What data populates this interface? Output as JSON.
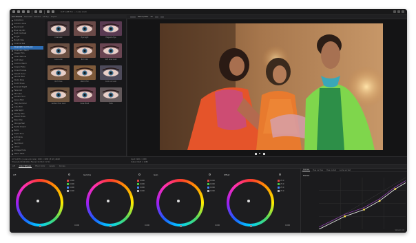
{
  "app": {
    "title": "LUT LAB Pro — Luxe Look",
    "toolbar_icons": [
      "new-file-icon",
      "open-folder-icon",
      "save-icon",
      "export-icon",
      "undo-icon",
      "redo-icon",
      "grid-icon",
      "crop-icon",
      "settings-icon"
    ]
  },
  "left_panel": {
    "tabs": [
      "LUT Presets",
      "Favorites",
      "Recent",
      "Library",
      "Import"
    ],
    "active_tab": 0,
    "selected_index": 8,
    "lut_items": [
      "Adventure",
      "Autumn Glow",
      "Black Gold",
      "Blue Sky ND",
      "Bold Contrast",
      "Bright",
      "Bright Vibe",
      "Cinema Teal",
      "Cinematic Gold Look",
      "Cinematic Warm",
      "Classic Film",
      "Clean Natural",
      "Cold Steel",
      "Colorful Warm",
      "Copper Fade",
      "Cross Process",
      "Desert Dune",
      "Drama Blue",
      "Dusty Rose",
      "Earth Tones",
      "Emerald Night",
      "Fade Out",
      "Film Noir",
      "Golden Hour",
      "Green Mist",
      "Hazy Summer",
      "Indie Film",
      "Late Night",
      "Moody Blue",
      "Muted Tones",
      "Neon Pop",
      "Orange Teal",
      "Pastel Dream",
      "Retro",
      "Sepia Tone",
      "Soft Glow",
      "Sunset",
      "Teal Mood",
      "Urban",
      "Vintage Fade",
      "Warm Haze"
    ],
    "thumbnails": [
      {
        "label": "Cinematic"
      },
      {
        "label": "Eye Light"
      },
      {
        "label": "Magenta Eye"
      },
      {
        "label": "Luxe Look"
      },
      {
        "label": "Rich Skin"
      },
      {
        "label": "Soft Glow Look"
      },
      {
        "label": "Rich Tone"
      },
      {
        "label": "Warm Film"
      },
      {
        "label": "Cool Lux Look"
      },
      {
        "label": "Golden Hour Look"
      },
      {
        "label": "Rosé Mood"
      },
      {
        "label": "Fade"
      }
    ]
  },
  "viewer": {
    "zoom": "Fit",
    "channel": "Before/After",
    "icons": [
      "zoom-icon",
      "compare-icon",
      "fullscreen-icon"
    ]
  },
  "info": {
    "line1": "LUT LAB Pro  |  Luxe Look.cube  |  1920 × 1080  |  8 bit  |  sRGB",
    "line2": "Timecode 00:00:08:14   Frame 214   Shot 3 of 12",
    "right1": "Input   1920 × 1080",
    "right2": "Output 1920 × 1080"
  },
  "color_panel": {
    "tabs": [
      "Lift",
      "Color Wheels",
      "HSL / Color",
      "Levels",
      "Curves"
    ],
    "active_tab": 1,
    "wheels": [
      {
        "title": "Lift",
        "values": [
          "0.000",
          "0.000",
          "0.000",
          "0.000"
        ],
        "foot": "0.000"
      },
      {
        "title": "Gamma",
        "values": [
          "0.000",
          "0.000",
          "0.000",
          "0.000"
        ],
        "foot": "0.000"
      },
      {
        "title": "Gain",
        "values": [
          "0.000",
          "0.000",
          "0.000",
          "0.000"
        ],
        "foot": "0.000"
      },
      {
        "title": "Offset",
        "values": [
          "25.0",
          "25.0",
          "25.0",
          "25.0"
        ],
        "foot": "0.000"
      }
    ],
    "curves": {
      "tabs": [
        "Curves",
        "Hue vs Hue",
        "Hue vs Sat",
        "Luma vs Sat"
      ],
      "title": "Master",
      "points": [
        [
          0,
          0
        ],
        [
          0.3,
          0.25
        ],
        [
          0.52,
          0.38
        ],
        [
          0.7,
          0.55
        ],
        [
          0.88,
          0.78
        ],
        [
          1,
          0.9
        ]
      ]
    },
    "version": "Version 1.0"
  }
}
